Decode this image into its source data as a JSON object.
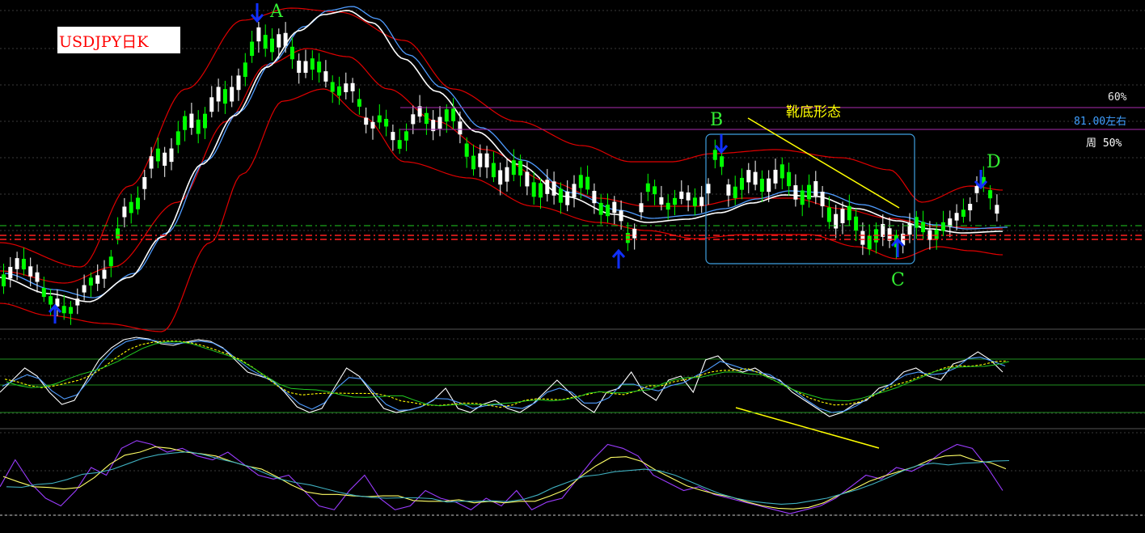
{
  "title": "USDJPY日K",
  "pattern_label": "靴底形态",
  "levels": {
    "pct60": "60%",
    "price": "81.00左右",
    "week50": "周 50%"
  },
  "points": {
    "A": "A",
    "B": "B",
    "C": "C",
    "D": "D"
  },
  "colors": {
    "bull": "#00ff00",
    "bear": "#ffffff",
    "band": "#e00000",
    "ma_white": "#ffffff",
    "ma_blue": "#4f9cff",
    "level_line": "#aa2bb0",
    "trend_line": "#ffff00",
    "box": "#3f9fdf",
    "arrow": "#1030ff",
    "price_label": "#3f9fff"
  },
  "chart_data": {
    "type": "candlestick",
    "title": "USDJPY日K",
    "price_series": [
      82.1,
      81.9,
      82.0,
      81.7,
      81.4,
      81.0,
      81.3,
      81.9,
      82.4,
      83.0,
      83.6,
      84.2,
      84.9,
      85.6,
      86.2,
      86.9,
      87.5,
      88.0,
      88.2,
      87.8,
      88.3,
      88.9,
      89.4,
      90.0,
      90.6,
      91.1,
      91.4,
      91.3,
      91.0,
      91.2,
      90.5,
      90.1,
      89.9,
      89.6,
      89.9,
      89.5,
      89.0,
      88.6,
      88.2,
      87.5,
      87.0,
      86.9,
      87.4,
      87.9,
      88.4,
      88.2,
      87.8,
      87.4,
      86.9,
      86.5,
      86.2,
      85.9,
      85.7,
      85.6,
      85.5,
      85.8,
      86.1,
      86.0,
      85.5,
      85.1,
      84.8,
      84.4,
      84.1,
      83.8,
      84.0,
      84.4,
      84.6,
      84.5,
      84.3,
      84.0,
      83.4,
      82.6,
      82.0,
      81.9,
      82.3,
      83.0,
      83.3,
      83.6,
      83.4,
      83.1,
      83.2,
      83.6,
      84.6,
      85.4,
      85.0,
      84.8,
      84.7,
      84.6,
      84.8,
      84.5,
      84.3,
      84.2,
      84.0,
      83.5,
      83.0,
      82.6,
      82.3,
      82.0,
      81.9,
      81.8,
      81.9,
      82.1,
      82.2,
      82.3,
      82.1,
      82.0,
      82.0,
      82.6,
      83.3,
      84.2,
      84.9,
      84.5,
      82.5
    ],
    "indicator_1": [
      0.3,
      0.45,
      0.6,
      0.5,
      0.3,
      0.15,
      0.2,
      0.45,
      0.7,
      0.85,
      0.95,
      0.98,
      0.96,
      0.9,
      0.88,
      0.92,
      0.95,
      0.93,
      0.85,
      0.7,
      0.55,
      0.5,
      0.45,
      0.3,
      0.12,
      0.05,
      0.1,
      0.35,
      0.6,
      0.5,
      0.3,
      0.1,
      0.05,
      0.08,
      0.12,
      0.2,
      0.35,
      0.1,
      0.05,
      0.15,
      0.2,
      0.1,
      0.05,
      0.15,
      0.3,
      0.45,
      0.3,
      0.15,
      0.05,
      0.3,
      0.35,
      0.55,
      0.3,
      0.2,
      0.45,
      0.5,
      0.3,
      0.7,
      0.75,
      0.6,
      0.55,
      0.6,
      0.5,
      0.45,
      0.3,
      0.2,
      0.1,
      0.0,
      0.05,
      0.15,
      0.2,
      0.35,
      0.4,
      0.55,
      0.6,
      0.5,
      0.45,
      0.65,
      0.7,
      0.8,
      0.7,
      0.55
    ],
    "indicator_2": [
      0.35,
      0.7,
      0.4,
      0.2,
      0.1,
      0.3,
      0.6,
      0.5,
      0.85,
      0.95,
      0.9,
      0.8,
      0.85,
      0.75,
      0.7,
      0.8,
      0.65,
      0.5,
      0.45,
      0.5,
      0.3,
      0.1,
      0.05,
      0.3,
      0.5,
      0.2,
      0.05,
      0.1,
      0.3,
      0.2,
      0.15,
      0.05,
      0.2,
      0.1,
      0.3,
      0.05,
      0.15,
      0.2,
      0.45,
      0.7,
      0.9,
      0.85,
      0.75,
      0.5,
      0.4,
      0.3,
      0.35,
      0.25,
      0.2,
      0.15,
      0.1,
      0.05,
      0.0,
      0.05,
      0.1,
      0.2,
      0.35,
      0.5,
      0.45,
      0.6,
      0.55,
      0.65,
      0.8,
      0.9,
      0.85,
      0.6,
      0.3
    ]
  }
}
